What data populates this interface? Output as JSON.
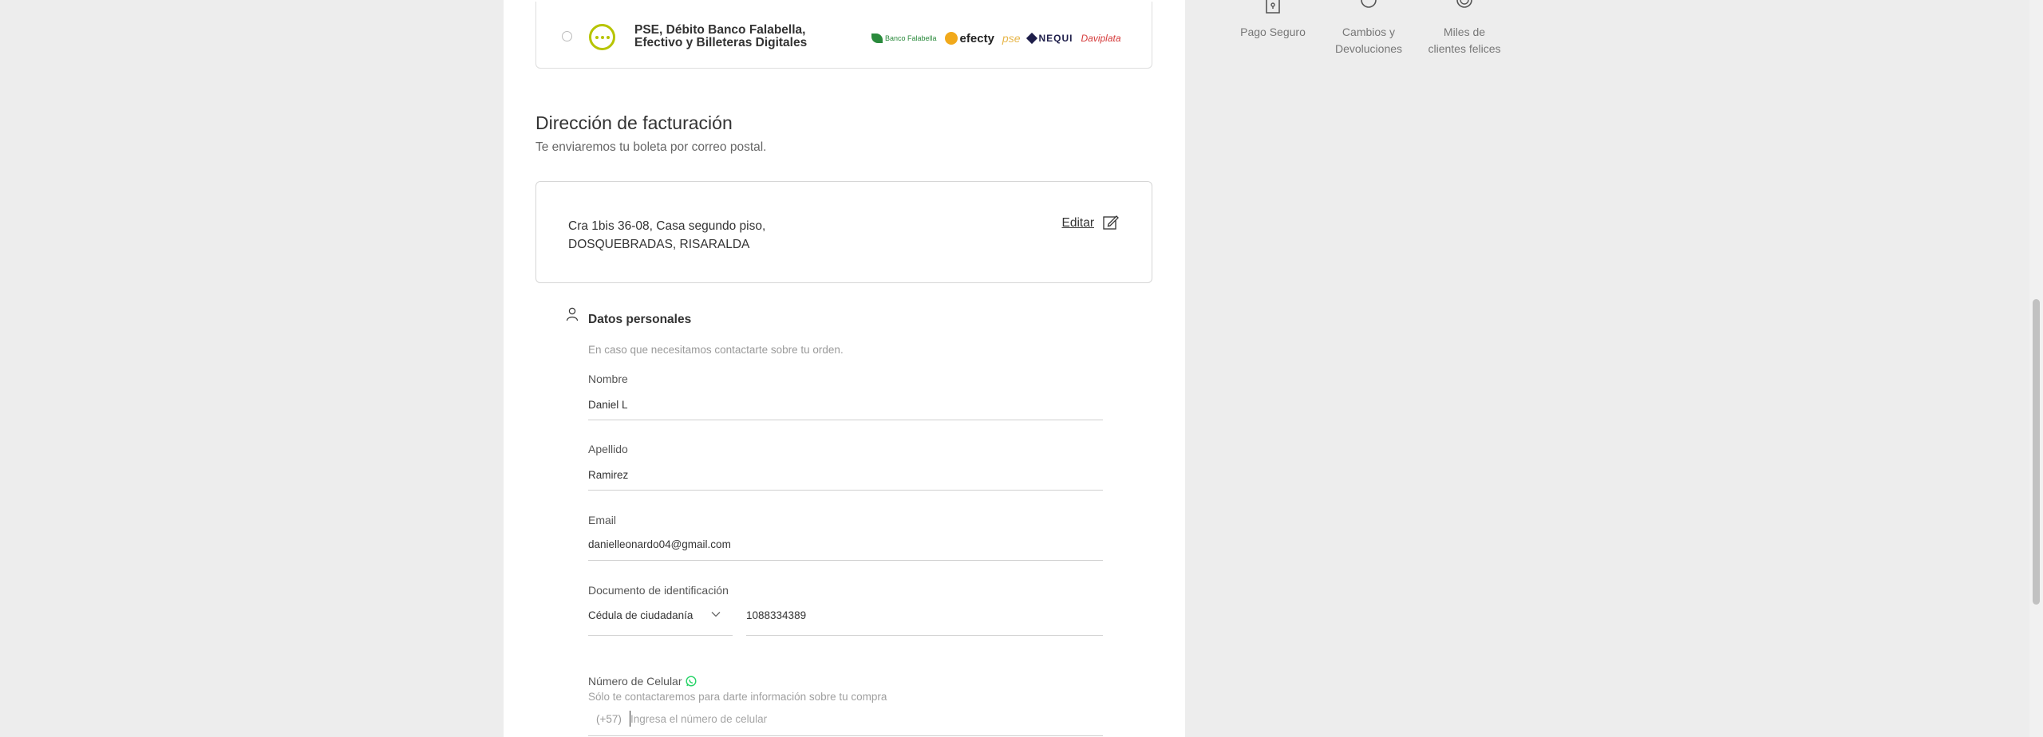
{
  "payment_option": {
    "title": "PSE, Débito Banco Falabella,\nEfectivo y Billeteras Digitales",
    "logos": [
      "Banco Falabella",
      "efecty",
      "pse",
      "NEQUI",
      "Daviplata"
    ]
  },
  "billing": {
    "title": "Dirección de facturación",
    "subtitle": "Te enviaremos tu boleta por correo postal.",
    "address_line1": "Cra 1bis 36-08, Casa segundo piso,",
    "address_line2": "DOSQUEBRADAS, RISARALDA",
    "edit_label": "Editar"
  },
  "personal": {
    "title": "Datos personales",
    "subtitle": "En caso que necesitamos contactarte sobre tu orden.",
    "first_name_label": "Nombre",
    "first_name_value": "Daniel L",
    "last_name_label": "Apellido",
    "last_name_value": "Ramirez",
    "email_label": "Email",
    "email_value": "danielleonardo04@gmail.com",
    "document_label": "Documento de identificación",
    "document_type": "Cédula de ciudadanía",
    "document_number": "1088334389",
    "phone_label": "Número de Celular",
    "phone_hint": "Sólo te contactaremos para darte información sobre tu compra",
    "phone_prefix": "(+57)",
    "phone_placeholder": "Ingresa el número de celular",
    "phone_value": ""
  },
  "badges": {
    "secure": "Pago Seguro",
    "returns_1": "Cambios y",
    "returns_2": "Devoluciones",
    "happy_1": "Miles de",
    "happy_2": "clientes felices"
  },
  "colors": {
    "accent": "#b7c400",
    "whatsapp": "#25d366",
    "background": "#ededed"
  }
}
